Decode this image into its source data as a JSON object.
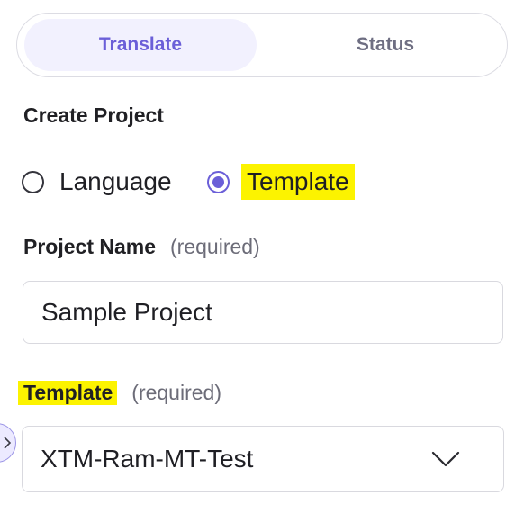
{
  "tabs": [
    {
      "label": "Translate",
      "active": true
    },
    {
      "label": "Status",
      "active": false
    }
  ],
  "section": {
    "title": "Create Project"
  },
  "project_type": {
    "options": [
      {
        "label": "Language",
        "selected": false
      },
      {
        "label": "Template",
        "selected": true
      }
    ]
  },
  "project_name": {
    "label": "Project Name",
    "required_text": "(required)",
    "value": "Sample Project"
  },
  "template": {
    "label": "Template",
    "required_text": "(required)",
    "selected_value": "XTM-Ram-MT-Test"
  },
  "colors": {
    "accent": "#6b5fd8",
    "active_tab_bg": "#f2f1fe",
    "highlight": "#fcf300",
    "border": "#d9d9df"
  },
  "icons": {
    "select_arrow": "chevron-down-icon",
    "edge_handle": "chevron-right-icon"
  }
}
